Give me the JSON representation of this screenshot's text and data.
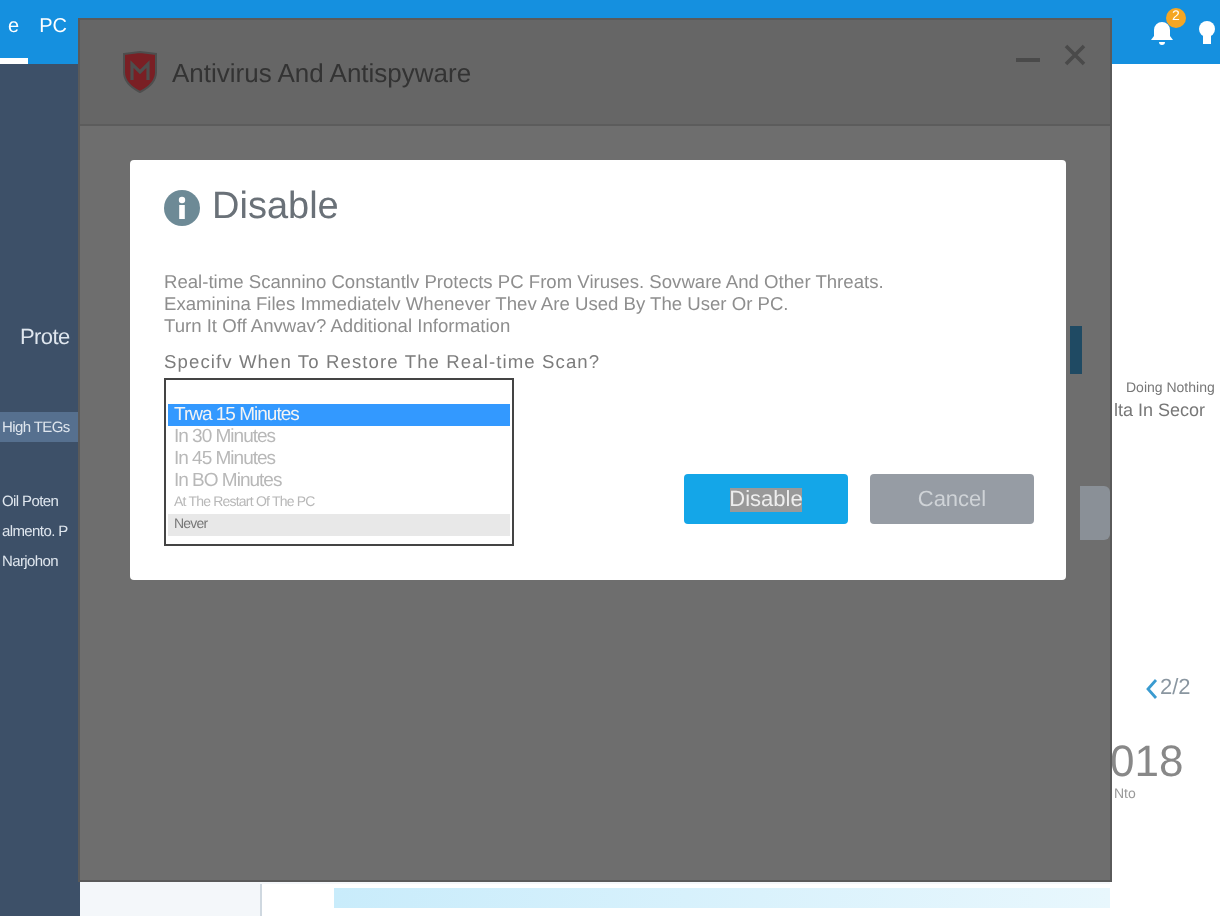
{
  "app": {
    "tabs": [
      {
        "label": "e",
        "selected": true
      },
      {
        "label": "PC",
        "selected": false
      }
    ],
    "notification_count": "2",
    "sidebar": {
      "items": [
        {
          "label": "Prote",
          "selected": false
        },
        {
          "label": "High TEGs",
          "selected": true
        },
        {
          "label": "Oil Poten",
          "selected": false
        },
        {
          "label": "almento. P",
          "selected": false
        },
        {
          "label": "Narjohon",
          "selected": false
        }
      ]
    },
    "right_panel": {
      "status": "Doing Nothing",
      "note": "lta In Secor",
      "pager": "2/2",
      "year": "018",
      "caption": "Nto"
    }
  },
  "window": {
    "title": "Antivirus And Antispyware"
  },
  "dialog": {
    "title": "Disable",
    "message_lines": [
      "Real-time Scannino Constantlv Protects PC From Viruses. Sovware And Other Threats.",
      "Examinina Files Immediatelv Whenever Thev Are Used By The User Or PC.",
      "Turn It Off Anvwav? Additional Information"
    ],
    "prompt": "Specifv When To Restore The Real-time Scan?",
    "options": [
      {
        "label": "Trwa 15 Minutes",
        "selected": true,
        "highlighted": false
      },
      {
        "label": "In 30 Minutes",
        "selected": false,
        "highlighted": false
      },
      {
        "label": "In 45 Minutes",
        "selected": false,
        "highlighted": false
      },
      {
        "label": "In BO Minutes",
        "selected": false,
        "highlighted": false
      },
      {
        "label": "At The Restart Of The PC",
        "selected": false,
        "highlighted": false
      },
      {
        "label": "Never",
        "selected": false,
        "highlighted": true
      }
    ],
    "buttons": [
      {
        "label": "Disable",
        "kind": "primary"
      },
      {
        "label": "Cancel",
        "kind": "secondary"
      }
    ]
  }
}
